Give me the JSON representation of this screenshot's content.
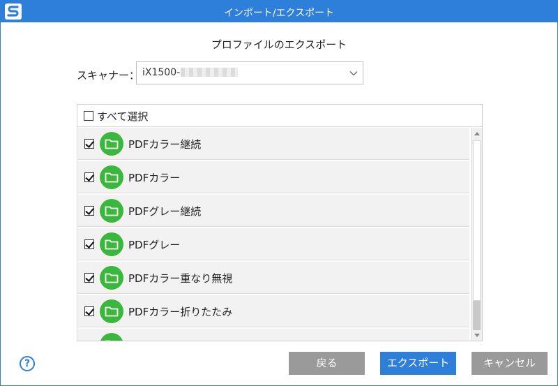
{
  "window": {
    "title": "インポート/エクスポート",
    "logo_icon": "scansnap-s-icon"
  },
  "heading": "プロファイルのエクスポート",
  "scanner": {
    "label": "スキャナー：",
    "value": "iX1500-",
    "value_obscured": true,
    "dropdown_icon": "chevron-down-icon"
  },
  "select_all": {
    "label": "すべて選択",
    "checked": false
  },
  "profiles": [
    {
      "name": "PDFカラー継続",
      "checked": true
    },
    {
      "name": "PDFカラー",
      "checked": true
    },
    {
      "name": "PDFグレー継続",
      "checked": true
    },
    {
      "name": "PDFグレー",
      "checked": true
    },
    {
      "name": "PDFカラー重なり無視",
      "checked": true
    },
    {
      "name": "PDFカラー折りたたみ",
      "checked": true
    },
    {
      "name": "",
      "checked": false
    }
  ],
  "colors": {
    "accent": "#2d7fd9",
    "folder_badge": "#3cb73d",
    "secondary_button": "#9a9a9a",
    "row_background": "#f2f2f2"
  },
  "buttons": {
    "back": "戻る",
    "export": "エクスポート",
    "cancel": "キャンセル"
  },
  "help_icon": "question-circle-icon",
  "help_glyph": "?"
}
